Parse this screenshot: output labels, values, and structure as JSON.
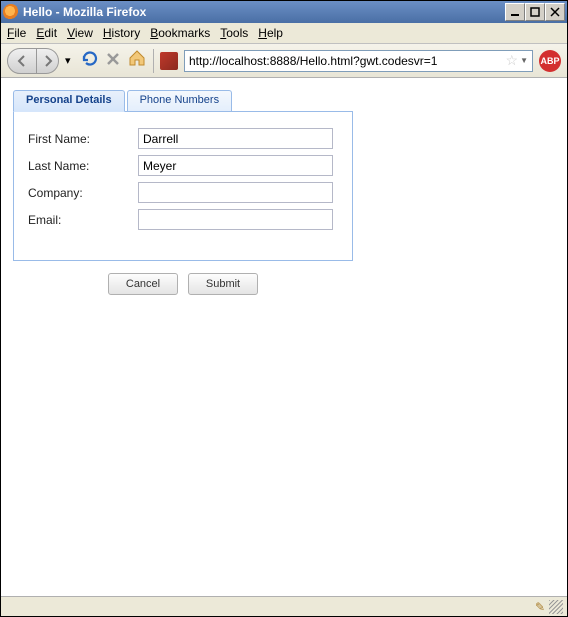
{
  "window": {
    "title": "Hello - Mozilla Firefox"
  },
  "menubar": {
    "items": [
      "File",
      "Edit",
      "View",
      "History",
      "Bookmarks",
      "Tools",
      "Help"
    ]
  },
  "toolbar": {
    "url": "http://localhost:8888/Hello.html?gwt.codesvr=1",
    "abp_label": "ABP"
  },
  "tabs": {
    "active": "Personal Details",
    "items": [
      {
        "label": "Personal Details"
      },
      {
        "label": "Phone Numbers"
      }
    ]
  },
  "form": {
    "fields": [
      {
        "label": "First Name:",
        "value": "Darrell"
      },
      {
        "label": "Last Name:",
        "value": "Meyer"
      },
      {
        "label": "Company:",
        "value": ""
      },
      {
        "label": "Email:",
        "value": ""
      }
    ]
  },
  "buttons": {
    "cancel": "Cancel",
    "submit": "Submit"
  }
}
